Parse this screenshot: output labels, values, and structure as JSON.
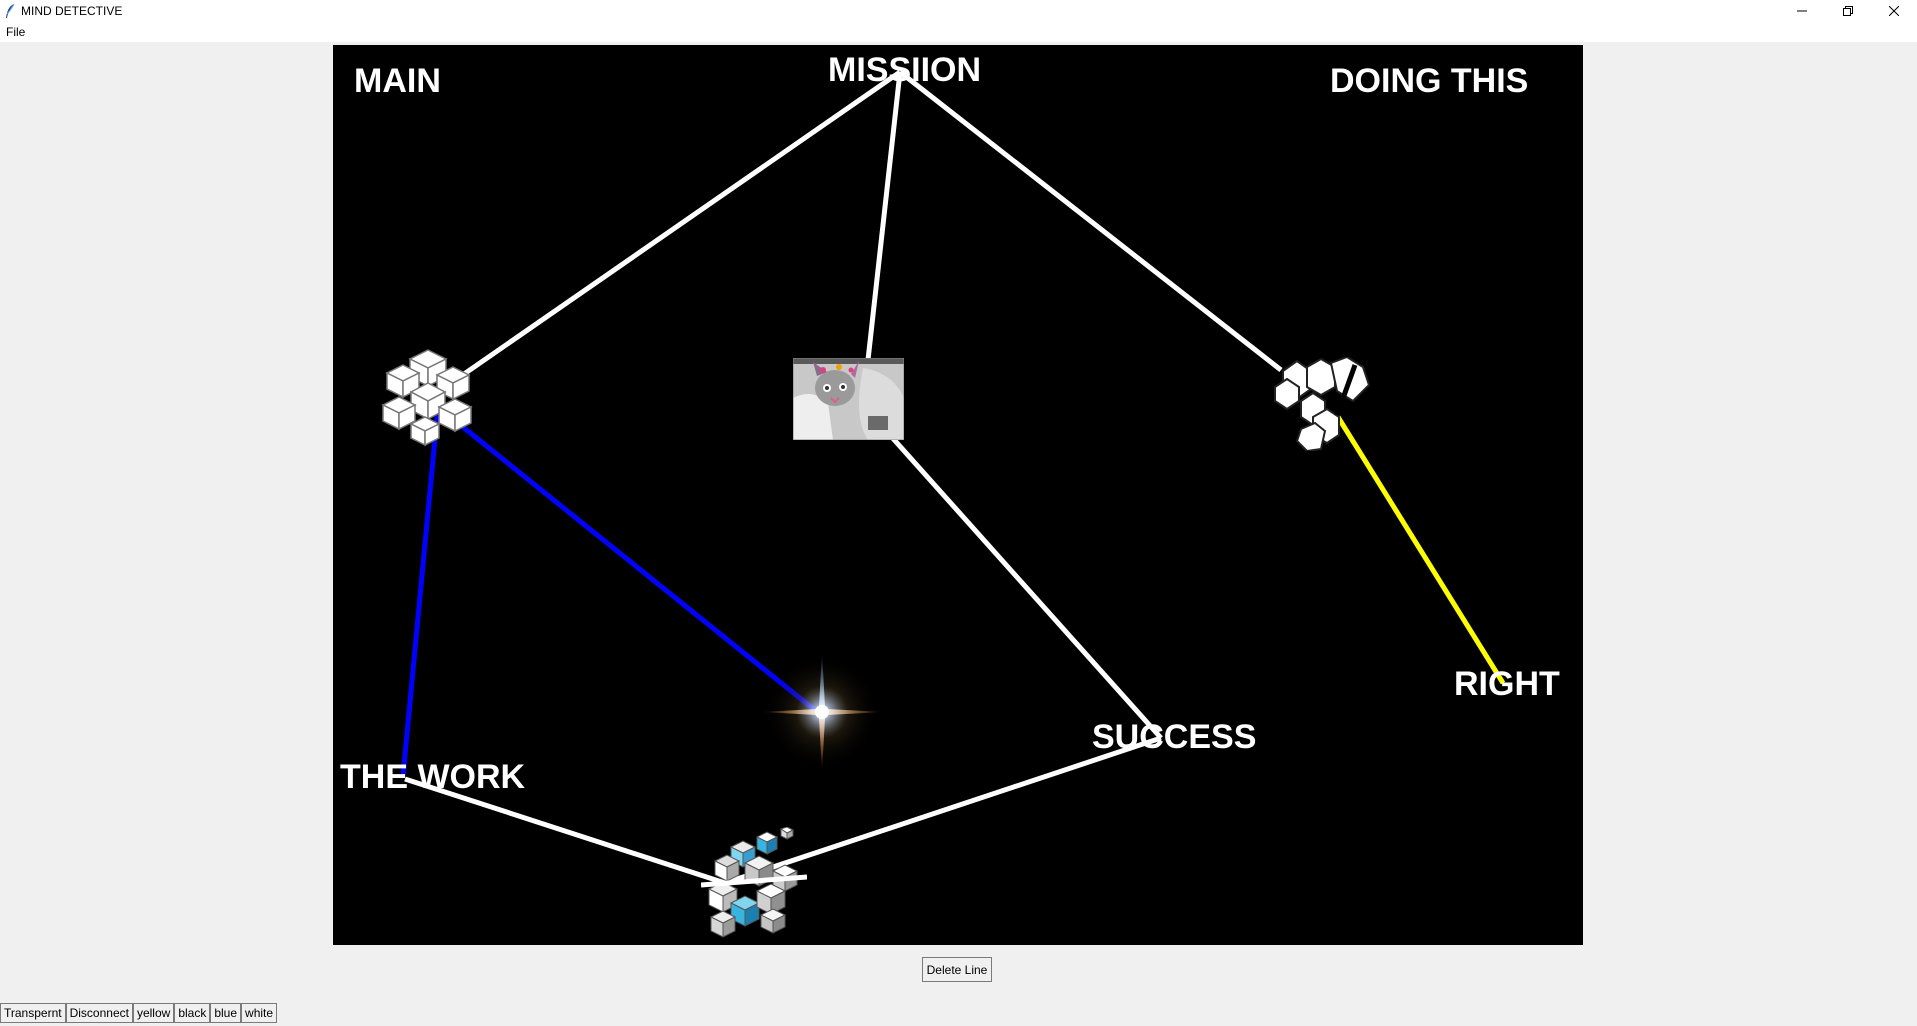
{
  "window": {
    "title": "MIND DETECTIVE",
    "controls": [
      "minimize",
      "maximize",
      "close"
    ]
  },
  "menubar": {
    "items": [
      "File"
    ]
  },
  "canvas": {
    "background": "#000000",
    "labels": [
      "MAIN",
      "MISSIION",
      "DOING THIS",
      "RIGHT",
      "SUCCESS",
      "THE WORK"
    ],
    "images": [
      {
        "icon": "white-cube-cluster-icon"
      },
      {
        "icon": "cat-photo-image"
      },
      {
        "icon": "white-cube-fragments-icon"
      },
      {
        "icon": "star-flare-image"
      },
      {
        "icon": "blue-cube-cluster-icon"
      }
    ],
    "lines": [
      {
        "color": "#ffffff"
      },
      {
        "color": "#ffffff"
      },
      {
        "color": "#ffffff"
      },
      {
        "color": "#ffffff"
      },
      {
        "color": "#ffffff"
      },
      {
        "color": "#ffffff"
      },
      {
        "color": "#0000ff"
      },
      {
        "color": "#0000ff"
      },
      {
        "color": "#ffff00"
      }
    ]
  },
  "actions": {
    "delete_line": "Delete Line"
  },
  "toolbar": {
    "buttons": [
      "Transpernt",
      "Disconnect",
      "yellow",
      "black",
      "blue",
      "white"
    ]
  }
}
